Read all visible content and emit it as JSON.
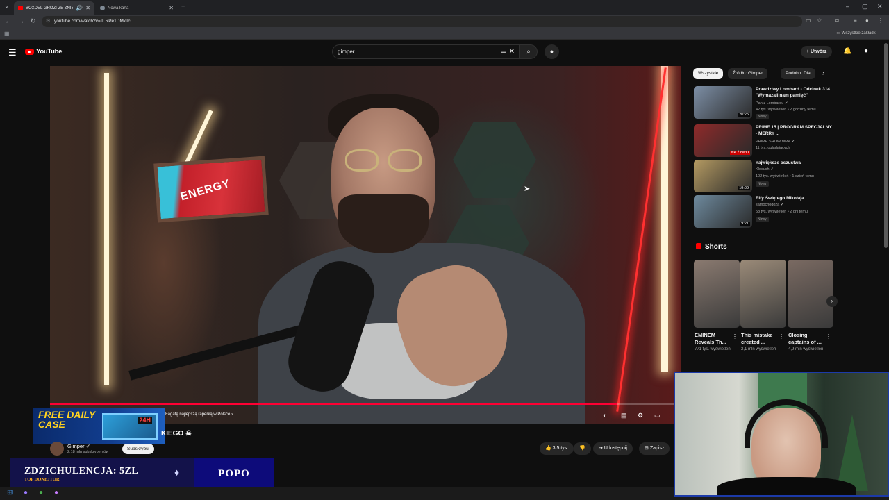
{
  "browser": {
    "tabs": [
      {
        "title": "BOXDEL GROZI ŻE ZNISZCZ",
        "active": true
      },
      {
        "title": "Nowa karta",
        "active": false
      }
    ],
    "url": "youtube.com/watch?v=JLRPe1DMkTc",
    "bookmarks_all": "Wszystkie zakładki"
  },
  "youtube": {
    "logo": "YouTube",
    "search_value": "gimper",
    "create_label": "Utwórz"
  },
  "player": {
    "progress": 0.9,
    "sign_text": "ENERGY",
    "chip_text": "Fagatę najlepszą raperką w Polsce",
    "title_fragment": "KIEGO ☠"
  },
  "channel": {
    "name": "Gimper",
    "subscribers": "2,18 mln subskrybentów",
    "subscribe_label": "Subskrybuj"
  },
  "actions": {
    "likes": "3,5 tys.",
    "share": "Udostępnij",
    "save": "Zapisz"
  },
  "overlay": {
    "free_daily_case": "FREE DAILY CASE",
    "free_daily_case_badge": "24H",
    "donation_main": "ZDZICHULENCJA: 5ZL",
    "donation_sub": "TOP DONEJTOR",
    "donation_name": "POPO"
  },
  "sidebar": {
    "chips": [
      "Wszystkie",
      "Źródło: Gimper",
      "Podobne",
      "Dla"
    ],
    "recommendations": [
      {
        "title": "Prawdziwy Lombard - Odcinek 314 \"Wymazali nam pamięć\"",
        "channel": "Pan z Lombardu",
        "meta": "42 tys. wyświetleń • 2 godziny temu",
        "badge": "Nowy",
        "duration": "20:25",
        "color": "#7d8fa6"
      },
      {
        "title": "PRIME 15 | PROGRAM SPECJALNY - MERRY ...",
        "channel": "PRIME SHOW MMA",
        "meta": "11 tys. oglądających",
        "badge": "",
        "duration": "NA ŻYWO",
        "color": "#8f2a2a"
      },
      {
        "title": "największe oszustwa",
        "channel": "Klocuch",
        "meta": "102 tys. wyświetleń • 1 dzień temu",
        "badge": "Nowy",
        "duration": "19:09",
        "color": "#b49a62"
      },
      {
        "title": "Elfy Świętego Mikołaja",
        "channel": "samochodoza",
        "meta": "58 tys. wyświetleń • 2 dni temu",
        "badge": "Nowy",
        "duration": "9:21",
        "color": "#6e8a9e"
      }
    ],
    "shorts_heading": "Shorts",
    "shorts": [
      {
        "title": "EMINEM Reveals Th...",
        "views": "771 tys. wyświetleń",
        "color": "#8a7a70"
      },
      {
        "title": "This mistake created ...",
        "views": "2,1 mln wyświetleń",
        "color": "#9a8a78"
      },
      {
        "title": "Closing captains of ...",
        "views": "4,9 mln wyświetleń",
        "color": "#7a6a62"
      }
    ]
  }
}
